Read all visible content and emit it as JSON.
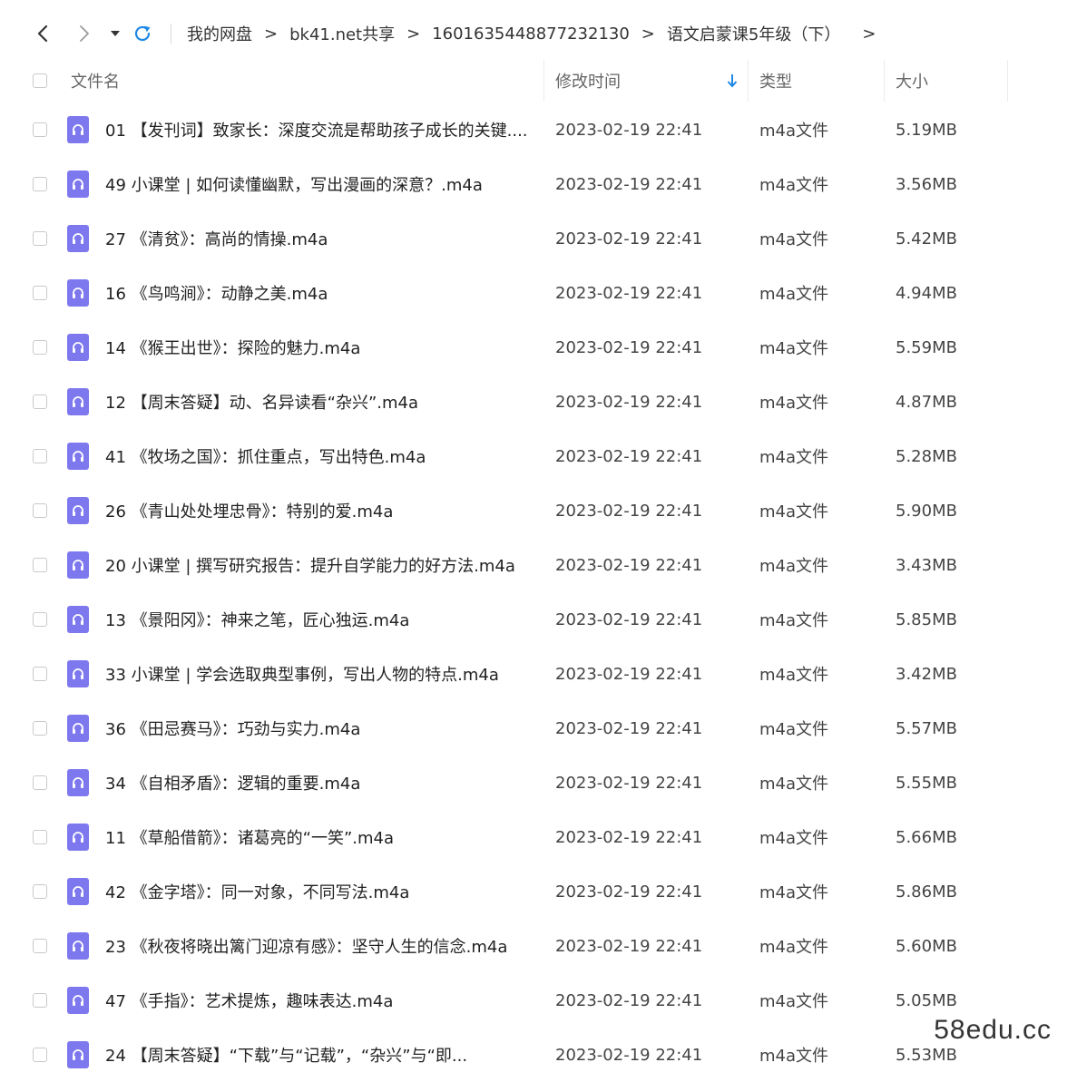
{
  "toolbar": {
    "back_icon": "chevron-left-icon",
    "forward_icon": "chevron-right-icon",
    "dropdown_icon": "caret-down-icon",
    "refresh_icon": "refresh-icon",
    "accent_color": "#1e88e5",
    "breadcrumb": [
      "我的网盘",
      "bk41.net共享",
      "1601635448877232130",
      "语文启蒙课5年级（下）"
    ],
    "breadcrumb_separator": ">",
    "breadcrumb_more": ">"
  },
  "header": {
    "name": "文件名",
    "modified": "修改时间",
    "type": "类型",
    "size": "大小",
    "sort_icon": "sort-down-arrow-icon"
  },
  "file_icon": "audio-headphones-icon",
  "file_icon_color": "#7d78ee",
  "files": [
    {
      "name": "01 【发刊词】致家长：深度交流是帮助孩子成长的关键....",
      "time": "2023-02-19 22:41",
      "type": "m4a文件",
      "size": "5.19MB"
    },
    {
      "name": "49 小课堂 | 如何读懂幽默，写出漫画的深意？.m4a",
      "time": "2023-02-19 22:41",
      "type": "m4a文件",
      "size": "3.56MB"
    },
    {
      "name": "27 《清贫》：高尚的情操.m4a",
      "time": "2023-02-19 22:41",
      "type": "m4a文件",
      "size": "5.42MB"
    },
    {
      "name": "16 《鸟鸣涧》：动静之美.m4a",
      "time": "2023-02-19 22:41",
      "type": "m4a文件",
      "size": "4.94MB"
    },
    {
      "name": "14 《猴王出世》：探险的魅力.m4a",
      "time": "2023-02-19 22:41",
      "type": "m4a文件",
      "size": "5.59MB"
    },
    {
      "name": "12 【周末答疑】动、名异读看“杂兴”.m4a",
      "time": "2023-02-19 22:41",
      "type": "m4a文件",
      "size": "4.87MB"
    },
    {
      "name": "41 《牧场之国》：抓住重点，写出特色.m4a",
      "time": "2023-02-19 22:41",
      "type": "m4a文件",
      "size": "5.28MB"
    },
    {
      "name": "26 《青山处处埋忠骨》：特别的爱.m4a",
      "time": "2023-02-19 22:41",
      "type": "m4a文件",
      "size": "5.90MB"
    },
    {
      "name": "20 小课堂 | 撰写研究报告：提升自学能力的好方法.m4a",
      "time": "2023-02-19 22:41",
      "type": "m4a文件",
      "size": "3.43MB"
    },
    {
      "name": "13 《景阳冈》：神来之笔，匠心独运.m4a",
      "time": "2023-02-19 22:41",
      "type": "m4a文件",
      "size": "5.85MB"
    },
    {
      "name": "33 小课堂 | 学会选取典型事例，写出人物的特点.m4a",
      "time": "2023-02-19 22:41",
      "type": "m4a文件",
      "size": "3.42MB"
    },
    {
      "name": "36 《田忌赛马》：巧劲与实力.m4a",
      "time": "2023-02-19 22:41",
      "type": "m4a文件",
      "size": "5.57MB"
    },
    {
      "name": "34 《自相矛盾》：逻辑的重要.m4a",
      "time": "2023-02-19 22:41",
      "type": "m4a文件",
      "size": "5.55MB"
    },
    {
      "name": "11 《草船借箭》：诸葛亮的“一笑”.m4a",
      "time": "2023-02-19 22:41",
      "type": "m4a文件",
      "size": "5.66MB"
    },
    {
      "name": "42 《金字塔》：同一对象，不同写法.m4a",
      "time": "2023-02-19 22:41",
      "type": "m4a文件",
      "size": "5.86MB"
    },
    {
      "name": "23 《秋夜将晓出篱门迎凉有感》：坚守人生的信念.m4a",
      "time": "2023-02-19 22:41",
      "type": "m4a文件",
      "size": "5.60MB"
    },
    {
      "name": "47 《手指》：艺术提炼，趣味表达.m4a",
      "time": "2023-02-19 22:41",
      "type": "m4a文件",
      "size": "5.05MB"
    },
    {
      "name": "24 【周末答疑】“下载”与“记载”，“杂兴”与“即...",
      "time": "2023-02-19 22:41",
      "type": "m4a文件",
      "size": "5.53MB"
    }
  ],
  "watermark": "58edu.cc"
}
